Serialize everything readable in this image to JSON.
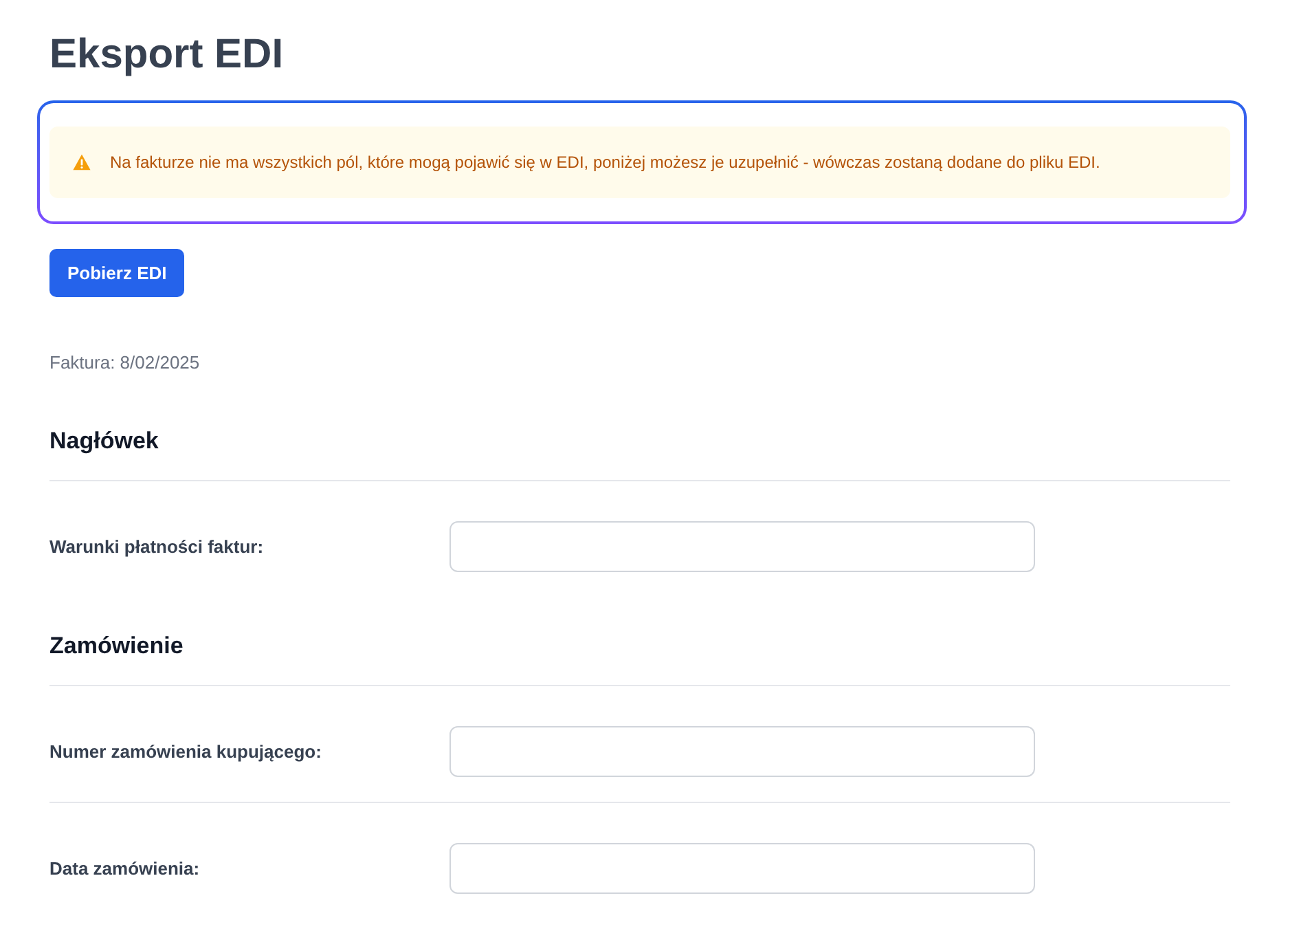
{
  "page": {
    "title": "Eksport EDI"
  },
  "alert": {
    "kind": "warning",
    "focused": true,
    "message": "Na fakturze nie ma wszystkich pól, które mogą pojawić się w EDI, poniżej możesz je uzupełnić - wówczas zostaną dodane do pliku EDI."
  },
  "download_button": {
    "label": "Pobierz EDI"
  },
  "invoice_info": "Faktura: 8/02/2025",
  "sections": [
    {
      "title": "Nagłówek",
      "fields": [
        {
          "label": "Warunki płatności faktur:"
        }
      ]
    },
    {
      "title": "Zamówienie",
      "fields": [
        {
          "label": "Numer zamówienia kupującego:"
        },
        {
          "label": "Data zamówienia:"
        }
      ]
    }
  ]
}
